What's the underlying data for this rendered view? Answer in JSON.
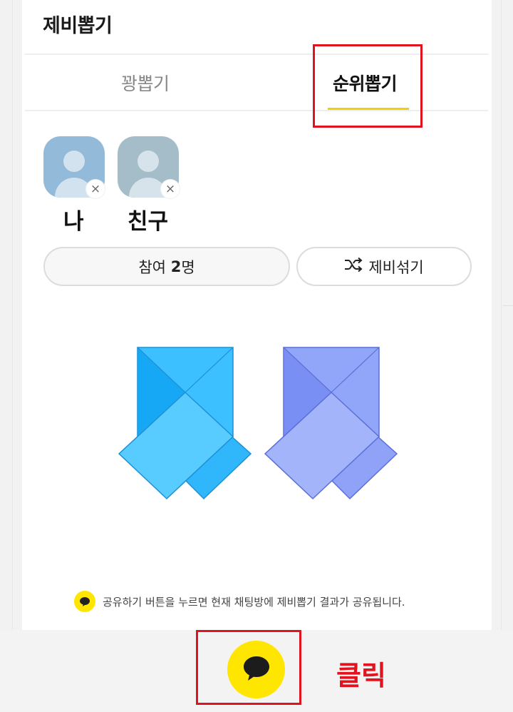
{
  "header": {
    "title": "제비뽑기"
  },
  "tabs": [
    {
      "label": "꽝뽑기",
      "active": false
    },
    {
      "label": "순위뽑기",
      "active": true
    }
  ],
  "participants": [
    {
      "name": "나"
    },
    {
      "name": "친구"
    }
  ],
  "remove_glyph": "×",
  "buttons": {
    "participants_prefix": "참여 ",
    "participants_count": "2",
    "participants_suffix": "명",
    "shuffle_label": "제비섞기"
  },
  "notice": {
    "text": "공유하기 버튼을 누르면 현재 채팅방에 제비뽑기 결과가 공유됩니다."
  },
  "annotation": {
    "click_label": "클릭",
    "color": "#e0141e"
  },
  "colors": {
    "accent_yellow": "#ffe600",
    "tab_underline": "#f4d000",
    "ticket_blue": "#3bbcff",
    "ticket_purple": "#8fa3f8"
  },
  "icons": {
    "shuffle": "shuffle-icon",
    "close": "close-icon",
    "chat": "chat-bubble-icon"
  }
}
